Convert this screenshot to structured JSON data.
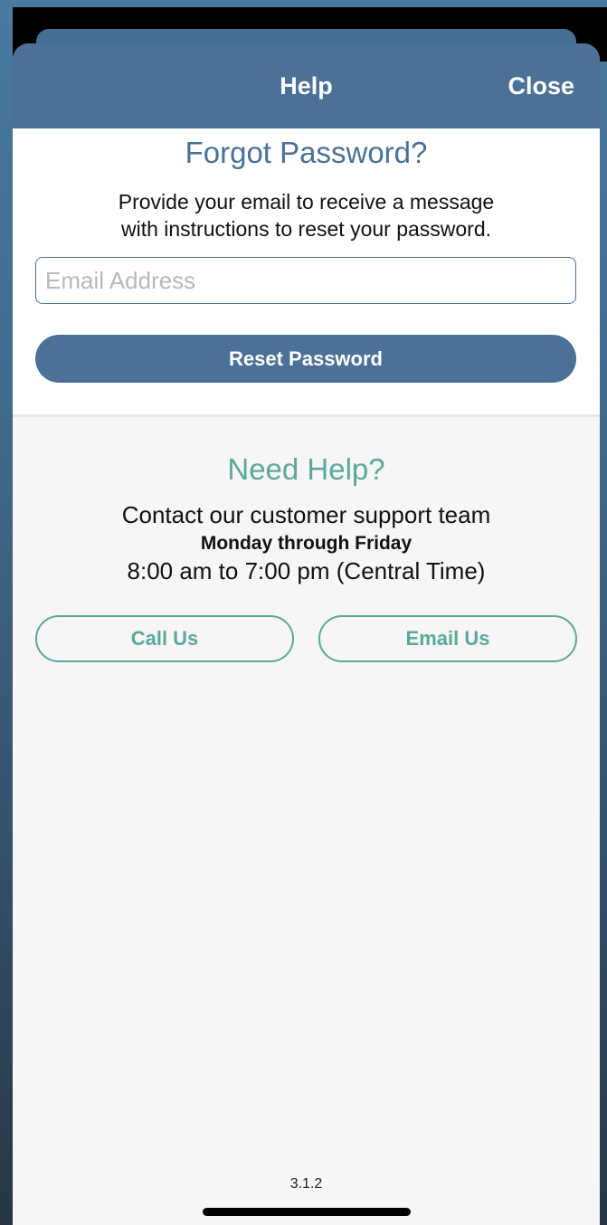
{
  "nav": {
    "title": "Help",
    "close_label": "Close"
  },
  "forgot": {
    "title": "Forgot Password?",
    "description_line1": "Provide your email to receive a message",
    "description_line2": "with instructions to reset your password.",
    "email_placeholder": "Email Address",
    "email_value": "",
    "reset_label": "Reset Password"
  },
  "help": {
    "title": "Need Help?",
    "line1": "Contact our customer support team",
    "line2": "Monday through Friday",
    "line3": "8:00 am to 7:00 pm (Central Time)",
    "call_label": "Call Us",
    "email_label": "Email Us"
  },
  "footer": {
    "version": "3.1.2"
  },
  "colors": {
    "primary": "#4b7196",
    "accent": "#5aa99c",
    "sheet_bg": "#f7f5f6"
  }
}
